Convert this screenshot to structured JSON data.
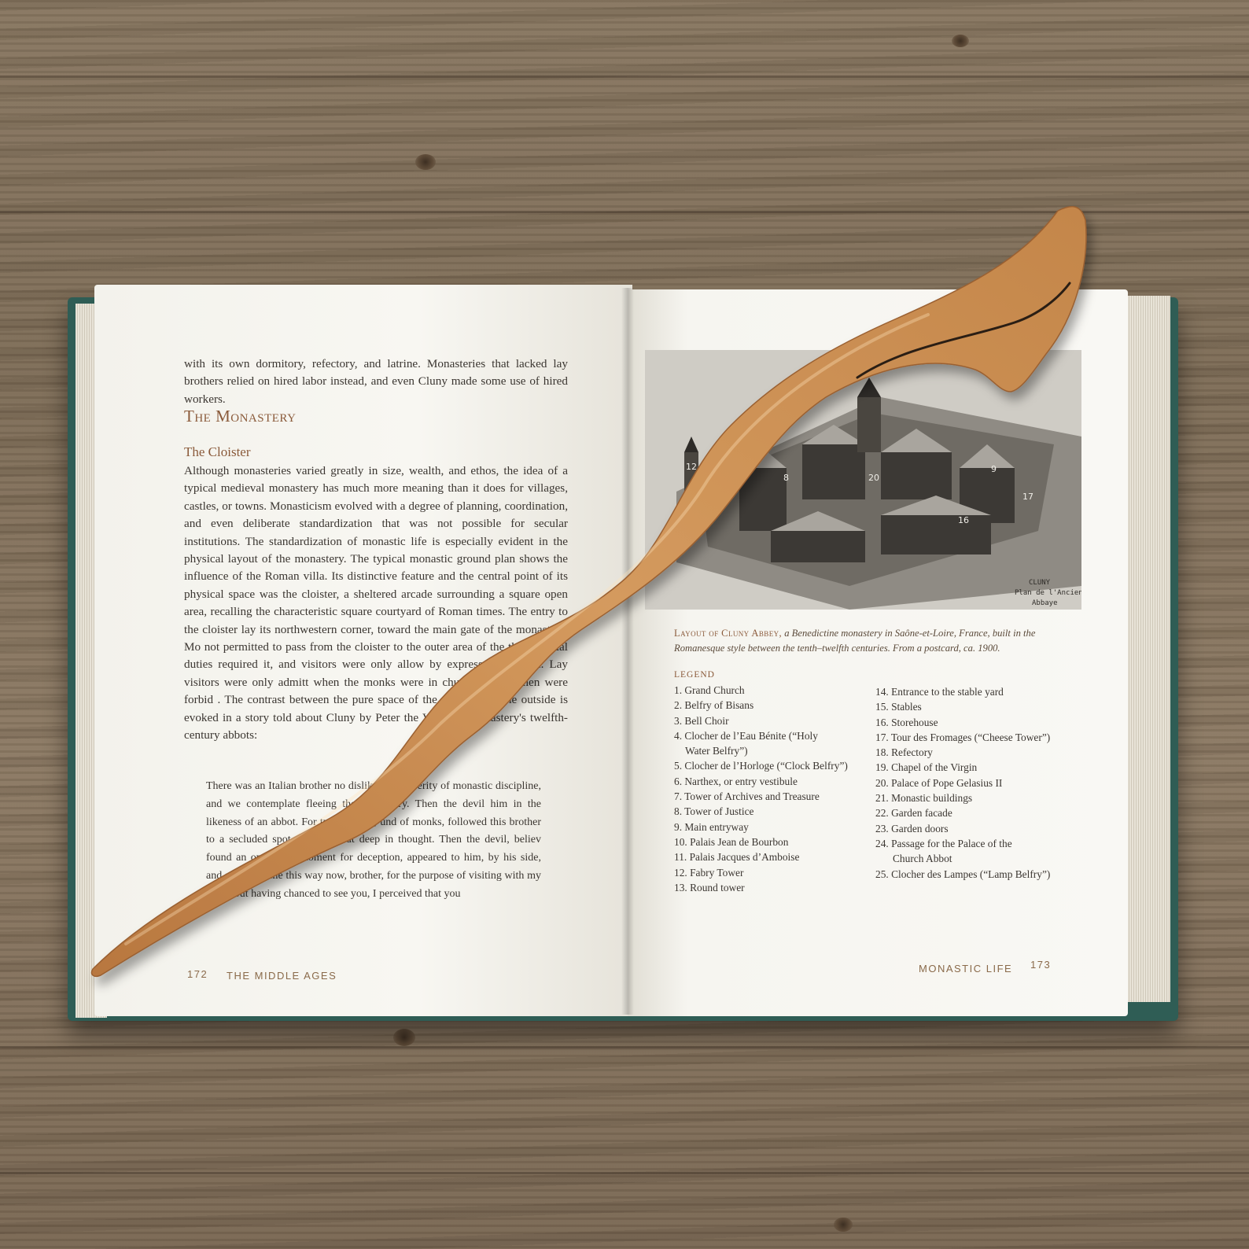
{
  "left_page": {
    "para_top": "with its own dormitory, refectory, and latrine. Monasteries that lacked lay brothers relied on hired labor instead, and even Cluny made some use of hired workers.",
    "section_title": "The Monastery",
    "subsection_title": "The Cloister",
    "para_main": "Although monasteries varied greatly in size, wealth, and ethos, the idea of a typical medieval monastery has much more meaning than it does for villages, castles, or towns. Monasticism evolved with a degree of planning, coordination, and even deliberate standardization that was not possible for secular institutions. The standardization of monastic life is especially evident in the physical layout of the monastery. The typical monastic ground plan shows the influence of the Roman villa. Its distinctive feature and the central point of its physical space was the cloister, a sheltered arcade surrounding a square open area, recalling the characteristic square courtyard of Roman times. The entry to the cloister lay its northwestern corner, toward the main gate of the monastery. Mo not permitted to pass from the cloister to the outer area of the their official duties required it, and visitors were only allow by express permission. Lay visitors were only admitt when the monks were in church, and women were forbid . The contrast between the pure space of the cloister and the outside is evoked in a story told about Cluny by Peter the Vener he monastery's twelfth-century abbots:",
    "block_quote": "There was an Italian brother no disliked the severity of monastic discipline, and we contemplate fleeing the monastery. Then the devil him in the likeness of an abbot. For two demons, und of monks, followed this brother to a secluded spot where he sat deep in thought. Then the devil, believ found an opportune moment for deception, appeared to him, by his side, and said, “I came this way now, brother, for the purpose of visiting with my hosts, but having chanced to see you, I perceived that you",
    "folio": "172",
    "running_head": "THE MIDDLE AGES"
  },
  "right_page": {
    "illustration": {
      "label_line1": "CLUNY",
      "label_line2": "Plan de l'Ancienne",
      "label_line3": "Abbaye",
      "numbers": [
        "12",
        "8",
        "20",
        "16",
        "9",
        "17"
      ]
    },
    "caption_lead": "Layout of Cluny Abbey,",
    "caption_text": " a Benedictine monastery in Saône-et-Loire, France, built in the Romanesque style between the tenth–twelfth centuries. From a postcard, ca. 1900.",
    "legend_title": "LEGEND",
    "legend_left": [
      "1. Grand Church",
      "2. Belfry of Bisans",
      "3. Bell Choir",
      "4. Clocher de l’Eau Bénite (“Holy",
      "    Water Belfry”)",
      "5. Clocher de l’Horloge (“Clock Belfry”)",
      "6. Narthex, or entry vestibule",
      "7. Tower of Archives and Treasure",
      "8. Tower of Justice",
      "9. Main entryway",
      "10. Palais Jean de Bourbon",
      "11. Palais Jacques d’Amboise",
      "12. Fabry Tower",
      "13. Round tower"
    ],
    "legend_right": [
      "14. Entrance to the stable yard",
      "15. Stables",
      "16. Storehouse",
      "17. Tour des Fromages (“Cheese Tower”)",
      "18. Refectory",
      "19. Chapel of the Virgin",
      "20. Palace of Pope Gelasius II",
      "21. Monastic buildings",
      "22. Garden facade",
      "23. Garden doors",
      "24. Passage for the Palace of the",
      "      Church Abbot",
      "25. Clocher des Lampes (“Lamp Belfry”)"
    ],
    "running_head": "MONASTIC LIFE",
    "folio": "173"
  },
  "colors": {
    "cover": "#2f5d55",
    "accent_text": "#8a5a3a",
    "wood_stick": "#c98a4e"
  }
}
